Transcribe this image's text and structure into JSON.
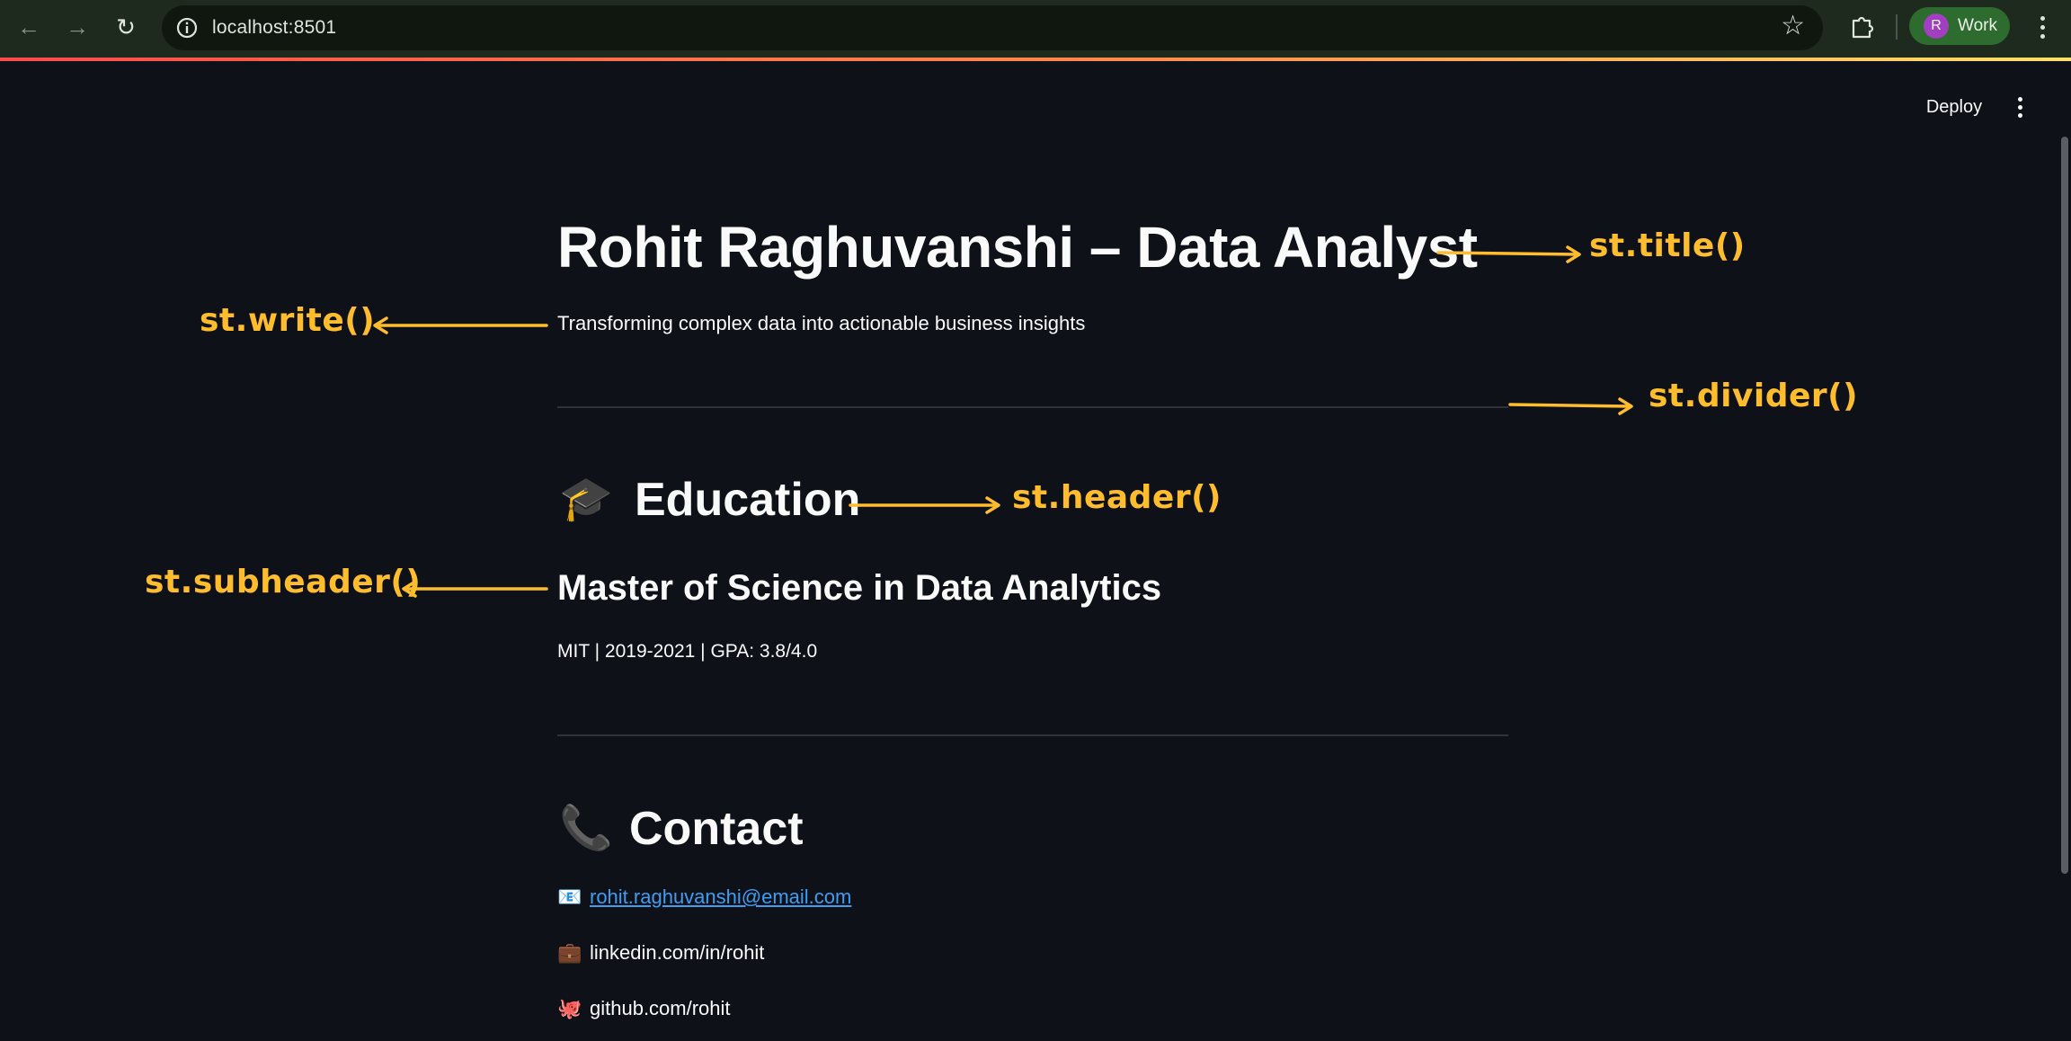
{
  "browser": {
    "url": "localhost:8501",
    "profile_initial": "R",
    "profile_name": "Work"
  },
  "app_header": {
    "deploy_label": "Deploy"
  },
  "content": {
    "title": "Rohit Raghuvanshi – Data Analyst",
    "subtitle": "Transforming complex data into actionable business insights",
    "education": {
      "icon": "graduation-cap-emoji",
      "icon_glyph": "🎓",
      "header": "Education",
      "subheader": "Master of Science in Data Analytics",
      "details": "MIT | 2019-2021 | GPA: 3.8/4.0"
    },
    "contact": {
      "icon": "telephone-emoji",
      "icon_glyph": "📞",
      "header": "Contact",
      "items": [
        {
          "icon": "envelope-emoji",
          "glyph": "📧",
          "text": "rohit.raghuvanshi@email.com",
          "is_link": true
        },
        {
          "icon": "briefcase-emoji",
          "glyph": "💼",
          "text": "linkedin.com/in/rohit",
          "is_link": false
        },
        {
          "icon": "octopus-emoji",
          "glyph": "🐙",
          "text": "github.com/rohit",
          "is_link": false
        }
      ]
    }
  },
  "annotations": {
    "title": "st.title()",
    "write": "st.write()",
    "divider": "st.divider()",
    "header": "st.header()",
    "subheader": "st.subheader()",
    "color": "#ffbd2e"
  },
  "colors": {
    "background": "#0e1117",
    "text": "#fafafa",
    "link": "#3d9df3",
    "annotation": "#ffbd2e",
    "chrome": "#1e2a1e"
  }
}
